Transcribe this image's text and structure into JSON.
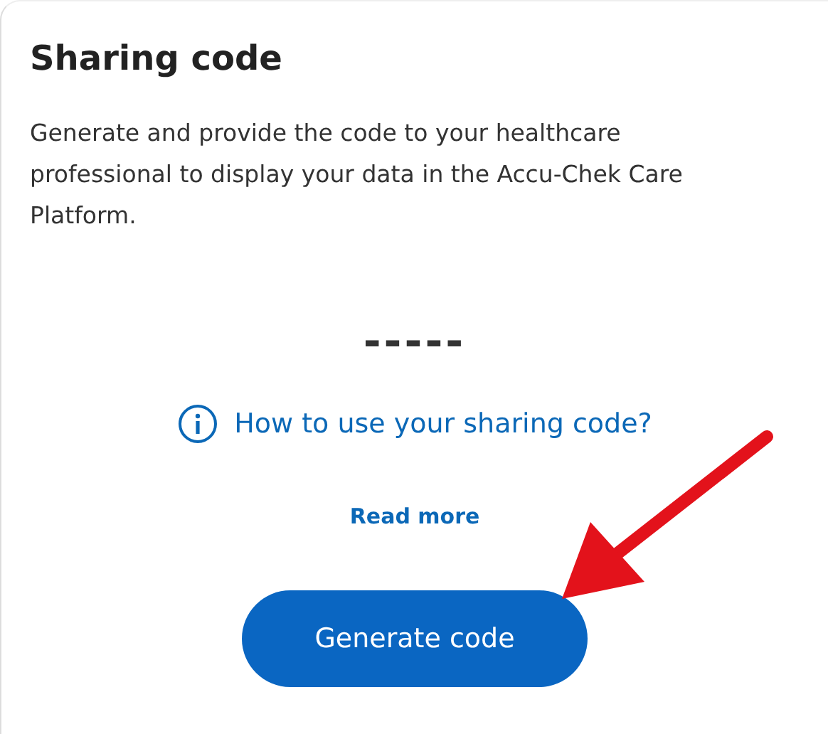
{
  "title": "Sharing code",
  "description": "Generate and provide the code to your healthcare professional to display your data in the Accu-Chek Care Platform.",
  "code": "-----",
  "help_link": "How to use your sharing code?",
  "read_more": "Read more",
  "button": "Generate code"
}
